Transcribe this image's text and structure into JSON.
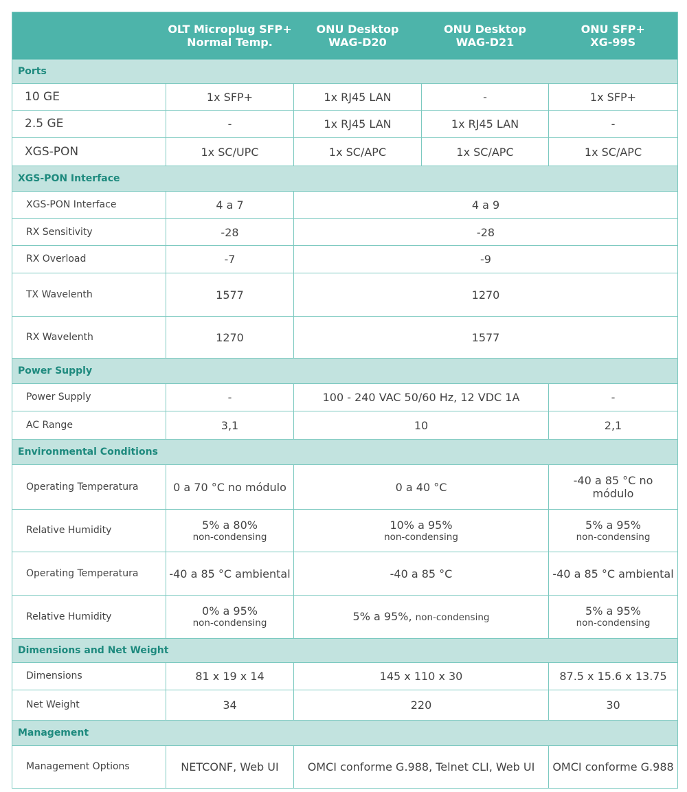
{
  "header": [
    "",
    "OLT Microplug SFP+\nNormal Temp.",
    "ONU Desktop\nWAG-D20",
    "ONU Desktop\nWAG-D21",
    "ONU SFP+\nXG-99S"
  ],
  "colors": {
    "header_bg": "#4db4aa",
    "section_bg": "#c2e3df",
    "section_text": "#1e8a7e",
    "border": "#7cc9c0"
  },
  "sections": [
    {
      "title": "Ports",
      "big": true,
      "rows": [
        {
          "label": "10 GE",
          "h": 39,
          "cells": [
            {
              "text": "1x SFP+"
            },
            {
              "text": "1x RJ45 LAN"
            },
            {
              "text": "-"
            },
            {
              "text": "1x SFP+"
            }
          ]
        },
        {
          "label": "2.5 GE",
          "h": 40,
          "cells": [
            {
              "text": "-"
            },
            {
              "text": "1x RJ45 LAN"
            },
            {
              "text": "1x RJ45 LAN"
            },
            {
              "text": "-"
            }
          ]
        },
        {
          "label": "XGS-PON",
          "h": 41,
          "cells": [
            {
              "text": "1x SC/UPC"
            },
            {
              "text": "1x SC/APC"
            },
            {
              "text": "1x SC/APC"
            },
            {
              "text": "1x SC/APC"
            }
          ]
        }
      ]
    },
    {
      "title": "XGS-PON Interface",
      "rows": [
        {
          "label": "XGS-PON Interface",
          "h": 40,
          "cells": [
            {
              "text": "4 a 7"
            },
            {
              "text": "4 a 9",
              "span": 3
            }
          ]
        },
        {
          "label": "RX Sensitivity",
          "h": 39,
          "cells": [
            {
              "text": "-28"
            },
            {
              "text": "-28",
              "span": 3
            }
          ]
        },
        {
          "label": "RX Overload",
          "h": 40,
          "cells": [
            {
              "text": "-7"
            },
            {
              "text": "-9",
              "span": 3
            }
          ]
        },
        {
          "label": "TX Wavelenth",
          "h": 63,
          "cells": [
            {
              "text": "1577"
            },
            {
              "text": "1270",
              "span": 3
            }
          ]
        },
        {
          "label": "RX Wavelenth",
          "h": 61,
          "cells": [
            {
              "text": "1270"
            },
            {
              "text": "1577",
              "span": 3
            }
          ]
        }
      ]
    },
    {
      "title": "Power Supply",
      "rows": [
        {
          "label": "Power Supply",
          "h": 40,
          "cells": [
            {
              "text": "-"
            },
            {
              "text": "100 - 240 VAC 50/60 Hz, 12 VDC 1A",
              "span": 2
            },
            {
              "text": "-"
            }
          ]
        },
        {
          "label": "AC Range",
          "h": 41,
          "cells": [
            {
              "text": "3,1"
            },
            {
              "text": "10",
              "span": 2
            },
            {
              "text": "2,1"
            }
          ]
        }
      ]
    },
    {
      "title": "Environmental Conditions",
      "rows": [
        {
          "label": "Operating Temperatura",
          "h": 65,
          "cells": [
            {
              "text": "0 a 70 °C no módulo"
            },
            {
              "text": "0 a 40 °C",
              "span": 2
            },
            {
              "text": "-40 a 85 °C no módulo"
            }
          ]
        },
        {
          "label": "Relative Humidity",
          "h": 62,
          "cells": [
            {
              "text": "5% a 80%",
              "sub": "non-condensing"
            },
            {
              "text": "10% a 95%",
              "sub": "non-condensing",
              "span": 2
            },
            {
              "text": "5% a 95%",
              "sub": "non-condensing"
            }
          ]
        },
        {
          "label": "Operating Temperatura",
          "h": 63,
          "cells": [
            {
              "text": "-40 a 85 °C ambiental"
            },
            {
              "text": "-40 a 85 °C",
              "span": 2
            },
            {
              "text": "-40 a 85 °C ambiental"
            }
          ]
        },
        {
          "label": "Relative Humidity",
          "h": 63,
          "cells": [
            {
              "text": "0% a 95%",
              "sub": "non-condensing"
            },
            {
              "text": "5% a 95%,",
              "inline": "non-condensing",
              "span": 2
            },
            {
              "text": "5% a 95%",
              "sub": "non-condensing"
            }
          ]
        }
      ]
    },
    {
      "title": "Dimensions and Net Weight",
      "rows": [
        {
          "label": "Dimensions",
          "h": 40,
          "cells": [
            {
              "text": "81 x 19 x 14"
            },
            {
              "text": "145 x 110 x 30",
              "span": 2
            },
            {
              "text": "87.5 x 15.6 x 13.75"
            }
          ]
        },
        {
          "label": "Net Weight",
          "h": 44,
          "cells": [
            {
              "text": "34"
            },
            {
              "text": "220",
              "span": 2
            },
            {
              "text": "30"
            }
          ]
        }
      ]
    },
    {
      "title": "Management",
      "rows": [
        {
          "label": "Management Options",
          "h": 62,
          "cells": [
            {
              "text": "NETCONF, Web UI"
            },
            {
              "text": "OMCI conforme G.988, Telnet CLI, Web UI",
              "span": 2
            },
            {
              "text": "OMCI conforme G.988"
            }
          ]
        }
      ]
    }
  ]
}
